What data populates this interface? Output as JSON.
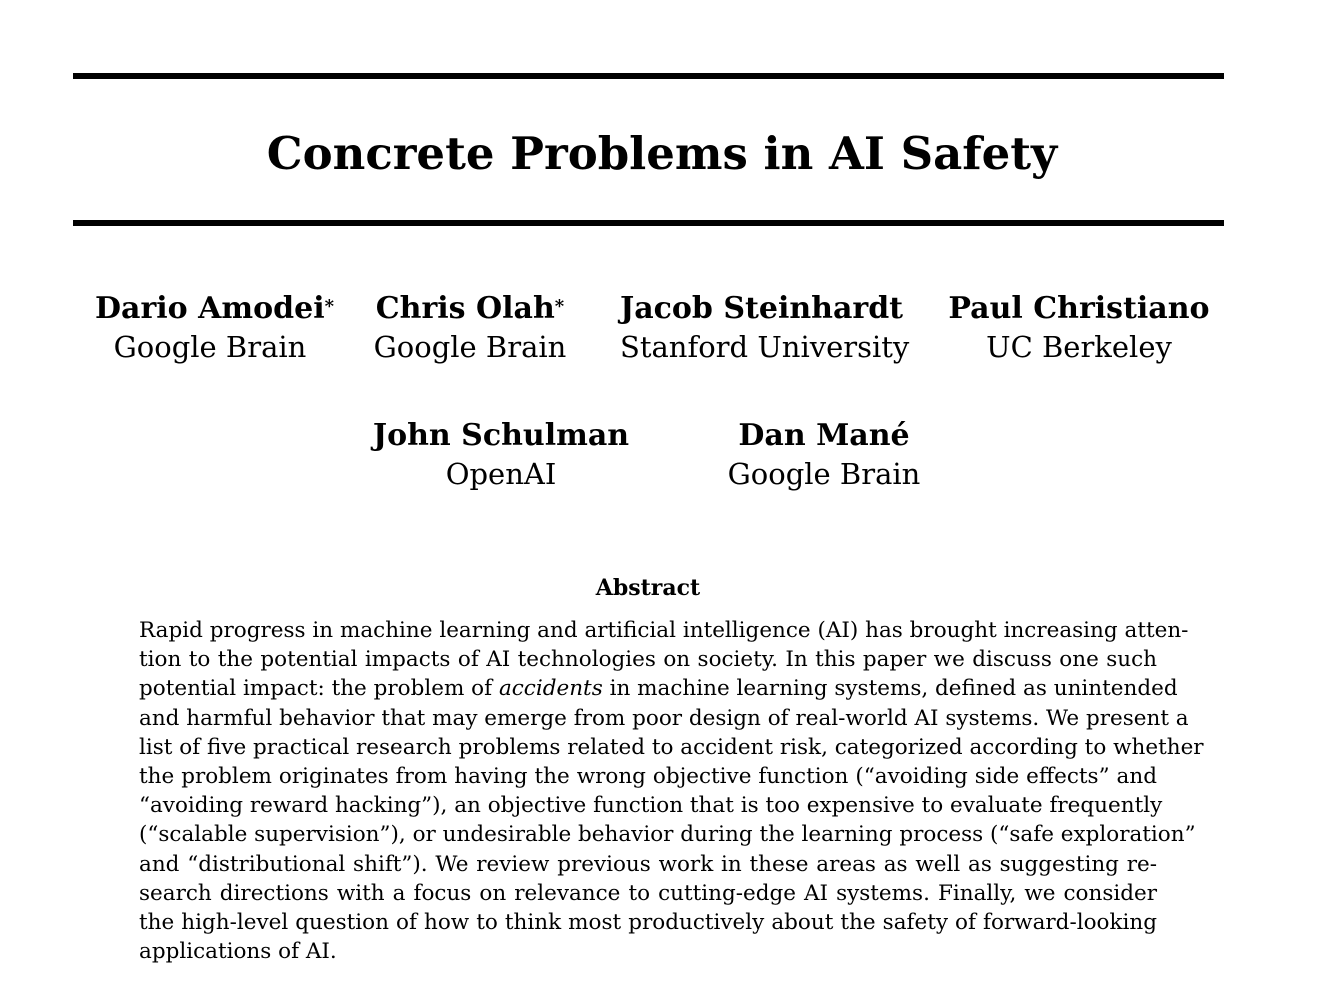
{
  "paper": {
    "title": "Concrete Problems in AI Safety",
    "authors": [
      {
        "name": "Dario Amodei",
        "mark": "*",
        "affiliation": "Google Brain"
      },
      {
        "name": "Chris Olah",
        "mark": "*",
        "affiliation": "Google Brain"
      },
      {
        "name": "Jacob Steinhardt",
        "mark": "",
        "affiliation": "Stanford University"
      },
      {
        "name": "Paul Christiano",
        "mark": "",
        "affiliation": "UC Berkeley"
      },
      {
        "name": "John Schulman",
        "mark": "",
        "affiliation": "OpenAI"
      },
      {
        "name": "Dan Mané",
        "mark": "",
        "affiliation": "Google Brain"
      }
    ],
    "abstract_heading": "Abstract",
    "abstract_lines": [
      "Rapid progress in machine learning and artificial intelligence (AI) has brought increasing atten-",
      "tion to the potential impacts of AI technologies on society. In this paper we discuss one such",
      "potential impact: the problem of",
      "accidents",
      "in machine learning systems, defined as unintended",
      "and harmful behavior that may emerge from poor design of real-world AI systems. We present a",
      "list of five practical research problems related to accident risk, categorized according to whether",
      "the problem originates from having the wrong objective function (“avoiding side effects” and",
      "“avoiding reward hacking”), an objective function that is too expensive to evaluate frequently",
      "(“scalable supervision”), or undesirable behavior during the learning process (“safe exploration”",
      "and “distributional shift”). We review previous work in these areas as well as suggesting re-",
      "search directions with a focus on relevance to cutting-edge AI systems. Finally, we consider",
      "the high-level question of how to think most productively about the safety of forward-looking",
      "applications of AI."
    ]
  }
}
